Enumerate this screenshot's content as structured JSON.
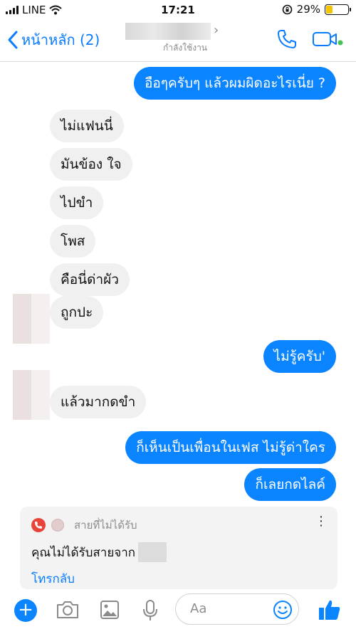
{
  "status_bar": {
    "carrier": "LINE",
    "time": "17:21",
    "battery": "29%"
  },
  "header": {
    "back_label": "หน้าหลัก (2)",
    "active_status": "กำลังใช้งาน"
  },
  "messages": [
    {
      "side": "out",
      "text": "อือๆครับๆ แล้วผมผิดอะไรเนี่ย ?"
    },
    {
      "side": "in",
      "text": "ไม่แฟนนี่"
    },
    {
      "side": "in",
      "text": "มันข้อง ใจ"
    },
    {
      "side": "in",
      "text": "ไปขำ"
    },
    {
      "side": "in",
      "text": "โพส"
    },
    {
      "side": "in",
      "text": "คือนี่ด่าผัว"
    },
    {
      "side": "in",
      "text": "ถูกปะ"
    },
    {
      "side": "out",
      "text": "ไม่รู้ครับ'"
    },
    {
      "side": "in",
      "text": "แล้วมากดขำ"
    },
    {
      "side": "out",
      "text": "ก็เห็นเป็นเพื่อนในเฟส ไม่รู้ด่าใคร"
    },
    {
      "side": "out",
      "text": "ก็เลยกดไลค์"
    }
  ],
  "missed_call_card": {
    "title": "สายที่ไม่ได้รับ",
    "text": "คุณไม่ได้รับสายจาก",
    "action": "โทรกลับ"
  },
  "composer": {
    "placeholder": "Aa"
  },
  "colors": {
    "accent": "#0a84ff",
    "incoming_bubble": "#f0f0f0",
    "missed_call_red": "#e8443a",
    "battery": "#f2c500"
  }
}
